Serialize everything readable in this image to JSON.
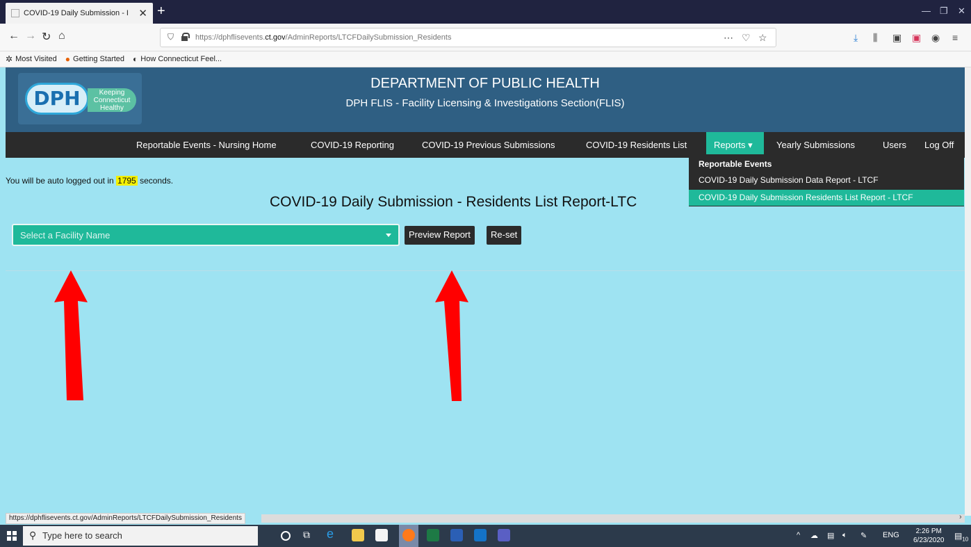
{
  "browser": {
    "tab_title": "COVID-19 Daily Submission - I",
    "url_host": "https://dphflisevents.",
    "url_domain": "ct.gov",
    "url_path": "/AdminReports/LTCFDailySubmission_Residents",
    "bookmarks": [
      "Most Visited",
      "Getting Started",
      "How Connecticut Feel..."
    ],
    "status_url": "https://dphflisevents.ct.gov/AdminReports/LTCFDailySubmission_Residents"
  },
  "header": {
    "logo_text": "DPH",
    "logo_tagline": "Keeping Connecticut Healthy",
    "title": "DEPARTMENT OF PUBLIC HEALTH",
    "subtitle": "DPH FLIS - Facility Licensing & Investigations Section(FLIS)"
  },
  "menu": {
    "items": [
      "Reportable Events - Nursing Home",
      "COVID-19 Reporting",
      "COVID-19 Previous Submissions",
      "COVID-19 Residents List"
    ],
    "reports": "Reports ▾",
    "yearly": "Yearly Submissions",
    "users": "Users",
    "logoff": "Log Off",
    "dropdown": [
      "Reportable Events",
      "COVID-19 Daily Submission Data Report - LTCF",
      "COVID-19 Daily Submission Residents List Report - LTCF"
    ]
  },
  "main": {
    "autolog_prefix": "You will be auto logged out in",
    "autolog_seconds": "1795",
    "autolog_suffix": "seconds.",
    "page_title": "COVID-19 Daily Submission - Residents List Report-LTC",
    "facility_placeholder": "Select a Facility Name",
    "preview_button": "Preview Report",
    "reset_button": "Re-set"
  },
  "taskbar": {
    "search_placeholder": "Type here to search",
    "lang": "ENG",
    "time": "2:26 PM",
    "date": "6/23/2020",
    "notif_count": "10"
  },
  "colors": {
    "page_bg": "#9ee3f2",
    "header_bg": "#2f5f83",
    "menu_bg": "#2b2b2b",
    "accent": "#1fb99a",
    "highlight": "#f4f000",
    "arrow": "#ff0000"
  }
}
